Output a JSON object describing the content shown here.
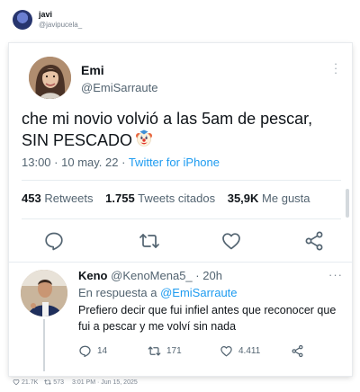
{
  "share_post": {
    "author_name": "javi",
    "author_handle": "@javipucela_",
    "footer": {
      "likes": "21.7K",
      "retweets": "573",
      "timestamp": "3:01 PM · Jun 15, 2025"
    }
  },
  "tweet": {
    "name": "Emi",
    "handle": "@EmiSarraute",
    "text": "che mi novio volvió a las 5am de pescar, SIN PESCADO",
    "time": "13:00",
    "date": "10 may. 22",
    "source": "Twitter for iPhone",
    "retweets_count": "453",
    "retweets_label": "Retweets",
    "quotes_count": "1.755",
    "quotes_label": "Tweets citados",
    "likes_count": "35,9K",
    "likes_label": "Me gusta"
  },
  "reply": {
    "name": "Keno",
    "handle": "@KenoMena5_",
    "age": "20h",
    "in_reply_prefix": "En respuesta a",
    "in_reply_mention": "@EmiSarraute",
    "text": "Prefiero decir que fui infiel antes que reconocer que fui a pescar y me volví sin nada",
    "replies": "14",
    "retweets": "171",
    "likes": "4.411"
  },
  "colors": {
    "link": "#1d9bf0",
    "secondary_text": "#536471",
    "icon": "#536471"
  }
}
